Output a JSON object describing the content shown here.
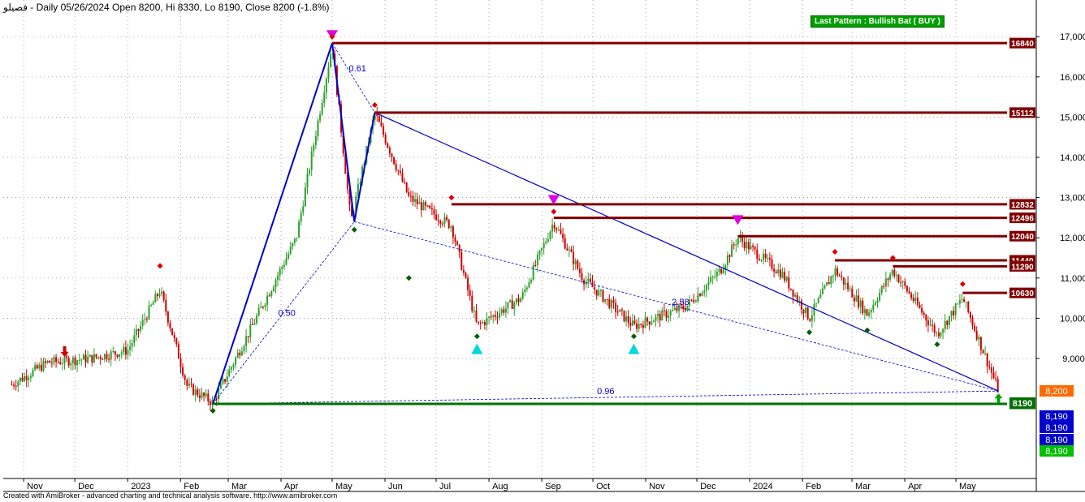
{
  "header": {
    "symbol": "فصيلو",
    "title_text": "- Daily 05/26/2024 Open 8200, Hi 8330, Lo 8190, Close 8200 (-1.8%)"
  },
  "footer": {
    "text": "Created with AmiBroker - advanced charting and technical analysis software. http://www.amibroker.com"
  },
  "pattern_label": "Last Pattern : Bullish Bat ( BUY )",
  "chart_data": {
    "type": "candlestick",
    "yaxis": {
      "ticks": [
        9000,
        10000,
        11000,
        12000,
        13000,
        14000,
        15000,
        16000,
        17000
      ],
      "tick_labels": [
        "9,000",
        "10,000",
        "11,000",
        "12,000",
        "13,000",
        "14,000",
        "15,000",
        "16,000",
        "17,000"
      ],
      "ylim": [
        7000,
        17500
      ]
    },
    "xaxis": {
      "labels": [
        "Nov",
        "Dec",
        "2023",
        "Feb",
        "Mar",
        "Apr",
        "May",
        "Jun",
        "Jul",
        "Aug",
        "Sep",
        "Oct",
        "Nov",
        "Dec",
        "2024",
        "Feb",
        "Mar",
        "Apr",
        "May"
      ]
    },
    "last_ohlc": {
      "date": "05/26/2024",
      "open": 8200,
      "high": 8330,
      "low": 8190,
      "close": 8200,
      "change_pct": -1.8
    },
    "price_path": [
      {
        "date": "2022-10-25",
        "price": 8350
      },
      {
        "date": "2022-11-15",
        "price": 8900
      },
      {
        "date": "2022-12-10",
        "price": 9000
      },
      {
        "date": "2023-01-01",
        "price": 9200
      },
      {
        "date": "2023-01-20",
        "price": 10700
      },
      {
        "date": "2023-02-05",
        "price": 8300
      },
      {
        "date": "2023-02-20",
        "price": 7900
      },
      {
        "date": "2023-03-15",
        "price": 9800
      },
      {
        "date": "2023-04-10",
        "price": 12000
      },
      {
        "date": "2023-05-01",
        "price": 16800
      },
      {
        "date": "2023-05-12",
        "price": 12400
      },
      {
        "date": "2023-05-26",
        "price": 15100
      },
      {
        "date": "2023-06-15",
        "price": 13000
      },
      {
        "date": "2023-07-10",
        "price": 12300
      },
      {
        "date": "2023-07-25",
        "price": 9800
      },
      {
        "date": "2023-08-20",
        "price": 10500
      },
      {
        "date": "2023-09-08",
        "price": 12400
      },
      {
        "date": "2023-09-25",
        "price": 11000
      },
      {
        "date": "2023-10-10",
        "price": 10400
      },
      {
        "date": "2023-10-25",
        "price": 9800
      },
      {
        "date": "2023-11-25",
        "price": 10300
      },
      {
        "date": "2023-12-15",
        "price": 11200
      },
      {
        "date": "2023-12-25",
        "price": 12000
      },
      {
        "date": "2024-01-20",
        "price": 11100
      },
      {
        "date": "2024-02-05",
        "price": 10000
      },
      {
        "date": "2024-02-20",
        "price": 11200
      },
      {
        "date": "2024-03-10",
        "price": 10100
      },
      {
        "date": "2024-03-25",
        "price": 11200
      },
      {
        "date": "2024-04-20",
        "price": 9600
      },
      {
        "date": "2024-05-05",
        "price": 10500
      },
      {
        "date": "2024-05-26",
        "price": 8200
      }
    ],
    "pattern_points": [
      {
        "label": "X",
        "date": "2023-02-20",
        "price": 7872
      },
      {
        "label": "A",
        "date": "2023-05-01",
        "price": 16840
      },
      {
        "label": "B",
        "date": "2023-05-14",
        "price": 12400
      },
      {
        "label": "C",
        "date": "2023-05-26",
        "price": 15112
      },
      {
        "label": "D",
        "date": "2024-05-26",
        "price": 8190
      }
    ],
    "ratios": [
      "0.61",
      "0.50",
      "2.58",
      "0.96"
    ],
    "levels": [
      {
        "label": "16840",
        "price": 16840,
        "color": "#800000",
        "start": "2023-05-01"
      },
      {
        "label": "15112",
        "price": 15112,
        "color": "#800000",
        "start": "2023-05-26"
      },
      {
        "label": "12832",
        "price": 12832,
        "color": "#800000",
        "start": "2023-07-10"
      },
      {
        "label": "12496",
        "price": 12496,
        "color": "#800000",
        "start": "2023-09-08"
      },
      {
        "label": "12040",
        "price": 12040,
        "color": "#800000",
        "start": "2023-12-25"
      },
      {
        "label": "11440",
        "price": 11440,
        "color": "#800000",
        "start": "2024-02-20"
      },
      {
        "label": "11290",
        "price": 11290,
        "color": "#800000",
        "start": "2024-03-25"
      },
      {
        "label": "10630",
        "price": 10630,
        "color": "#800000",
        "start": "2024-05-05"
      },
      {
        "label": "7872",
        "price": 7872,
        "color": "#007000",
        "start": "2023-02-20"
      }
    ],
    "price_tags": [
      {
        "label": "8,200",
        "price": 8200,
        "color": "#ff6a00"
      },
      {
        "label": "8190",
        "price": 8190,
        "color": "#007000"
      },
      {
        "label": "8,190",
        "price": 8190,
        "color": "#0000cc"
      },
      {
        "label": "8,190",
        "price": 8190,
        "color": "#0000cc"
      },
      {
        "label": "8,190",
        "price": 8190,
        "color": "#0000cc"
      },
      {
        "label": "8,190",
        "price": 8190,
        "color": "#00c000"
      }
    ],
    "markers": [
      {
        "shape": "tri-down",
        "date": "2023-05-01",
        "price": 17000,
        "color": "#e000e0"
      },
      {
        "shape": "tri-down",
        "date": "2023-09-08",
        "price": 12900,
        "color": "#e000e0"
      },
      {
        "shape": "tri-down",
        "date": "2023-12-25",
        "price": 12400,
        "color": "#e000e0"
      },
      {
        "shape": "tri-up",
        "date": "2023-07-25",
        "price": 9250,
        "color": "#00d8e0"
      },
      {
        "shape": "tri-up",
        "date": "2023-10-25",
        "price": 9250,
        "color": "#00d8e0"
      },
      {
        "shape": "arrow-down",
        "date": "2022-11-25",
        "price": 9100,
        "color": "#cc0000"
      },
      {
        "shape": "arrow-up",
        "date": "2024-05-26",
        "price": 8050,
        "color": "#00a000"
      },
      {
        "shape": "diamond",
        "date": "2023-05-01",
        "price": 17000,
        "color": "#dd0000"
      },
      {
        "shape": "diamond",
        "date": "2023-05-26",
        "price": 15300,
        "color": "#dd0000"
      },
      {
        "shape": "diamond",
        "date": "2023-07-10",
        "price": 13000,
        "color": "#dd0000"
      },
      {
        "shape": "diamond",
        "date": "2023-09-08",
        "price": 12650,
        "color": "#dd0000"
      },
      {
        "shape": "diamond",
        "date": "2024-02-20",
        "price": 11650,
        "color": "#dd0000"
      },
      {
        "shape": "diamond",
        "date": "2024-03-25",
        "price": 11500,
        "color": "#dd0000"
      },
      {
        "shape": "diamond",
        "date": "2024-05-05",
        "price": 10850,
        "color": "#dd0000"
      },
      {
        "shape": "diamond",
        "date": "2023-01-20",
        "price": 11300,
        "color": "#dd0000"
      },
      {
        "shape": "diamond",
        "date": "2023-02-20",
        "price": 7700,
        "color": "#006000"
      },
      {
        "shape": "diamond",
        "date": "2023-05-14",
        "price": 12200,
        "color": "#006000"
      },
      {
        "shape": "diamond",
        "date": "2023-06-15",
        "price": 11000,
        "color": "#006000"
      },
      {
        "shape": "diamond",
        "date": "2023-07-25",
        "price": 9550,
        "color": "#006000"
      },
      {
        "shape": "diamond",
        "date": "2023-10-25",
        "price": 9550,
        "color": "#006000"
      },
      {
        "shape": "diamond",
        "date": "2024-02-05",
        "price": 9650,
        "color": "#006000"
      },
      {
        "shape": "diamond",
        "date": "2024-03-10",
        "price": 9700,
        "color": "#006000"
      },
      {
        "shape": "diamond",
        "date": "2024-04-20",
        "price": 9350,
        "color": "#006000"
      }
    ]
  }
}
